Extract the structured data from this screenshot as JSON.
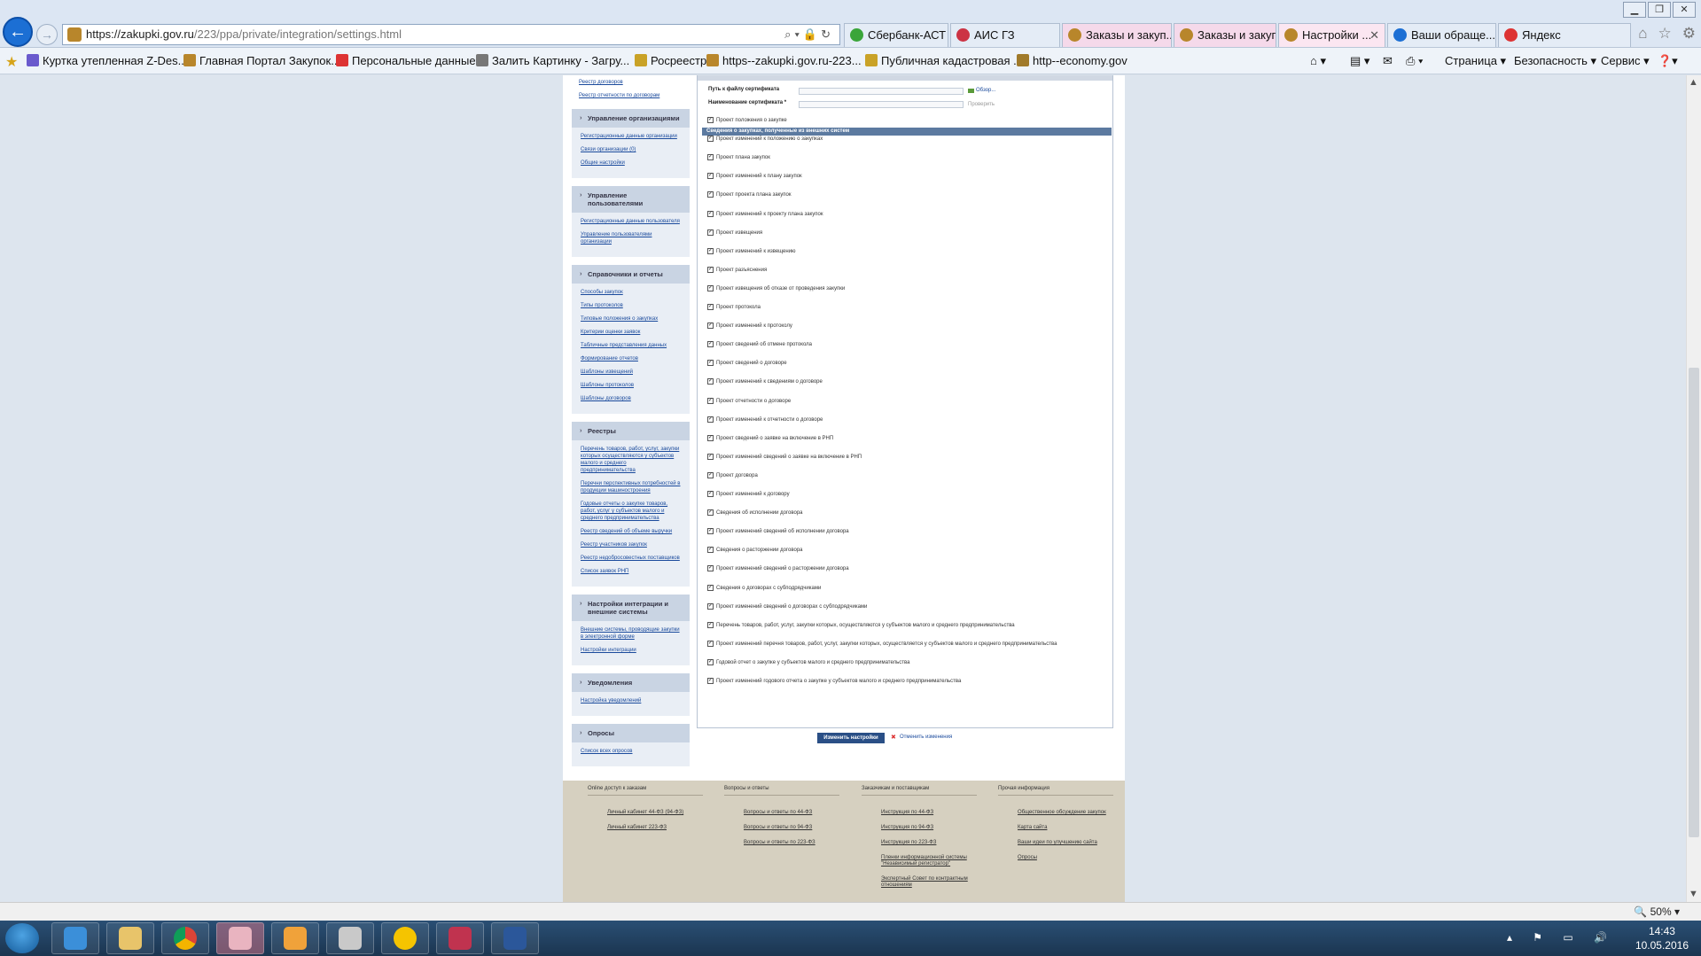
{
  "browser": {
    "url_host": "https://zakupki.gov.ru",
    "url_path": "/223/ppa/private/integration/settings.html",
    "tabs": [
      {
        "label": "Сбербанк-АСТ",
        "color": "#3aa53a"
      },
      {
        "label": "АИС ГЗ",
        "color": "#c34"
      },
      {
        "label": "Заказы и закуп...",
        "color": "#b8862b"
      },
      {
        "label": "Заказы и закуп...",
        "color": "#b8862b"
      },
      {
        "label": "Настройки ...",
        "color": "#b8862b"
      },
      {
        "label": "Ваши обраще...",
        "color": "#1c6fd4"
      },
      {
        "label": "Яндекс",
        "color": "#d33"
      }
    ],
    "favorites": [
      "Куртка утепленная Z-Des...",
      "Главная Портал Закупок...",
      "Персональные данные",
      "Залить Картинку - Загру...",
      "Росреестр",
      "https--zakupki.gov.ru-223...",
      "Публичная кадастровая ...",
      "http--economy.gov"
    ],
    "commands": {
      "page": "Страница",
      "security": "Безопасность",
      "service": "Сервис"
    },
    "zoom": "50%"
  },
  "sidebar": {
    "top_links": [
      "Реестр договоров",
      "Реестр отчетности по договорам"
    ],
    "groups": [
      {
        "title": "Управление организациями",
        "links": [
          "Регистрационные данные организации",
          "Связи организации (0)",
          "Общие настройки"
        ]
      },
      {
        "title": "Управление пользователями",
        "links": [
          "Регистрационные данные пользователя",
          "Управление пользователями организации"
        ]
      },
      {
        "title": "Справочники и отчеты",
        "links": [
          "Способы закупок",
          "Типы протоколов",
          "Типовые положения о закупках",
          "Критерии оценки заявок",
          "Табличные представления данных",
          "Формирование отчетов",
          "Шаблоны извещений",
          "Шаблоны протоколов",
          "Шаблоны договоров"
        ]
      },
      {
        "title": "Реестры",
        "links": [
          "Перечень товаров, работ, услуг, закупки которых осуществляются у субъектов малого и среднего предпринимательства",
          "Перечни перспективных потребностей в продукции машиностроения",
          "Годовые отчеты о закупке товаров, работ, услуг у субъектов малого и среднего предпринимательства",
          "Реестр сведений об объеме выручки",
          "Реестр участников закупок",
          "Реестр недобросовестных поставщиков",
          "Список заявок РНП"
        ]
      },
      {
        "title": "Настройки интеграции и внешние системы",
        "links": [
          "Внешние системы, проводящие закупки в электронной форме",
          "Настройки интеграции"
        ]
      },
      {
        "title": "Уведомления",
        "links": [
          "Настройка уведомлений"
        ]
      },
      {
        "title": "Опросы",
        "links": [
          "Список всех опросов"
        ]
      }
    ]
  },
  "main": {
    "cert_path_label": "Путь к файлу сертификата",
    "cert_name_label": "Наименование сертификата *",
    "browse_label": "Обзор...",
    "check_label": "Проверить",
    "section_title": "Сведения о закупках, полученные из внешних систем",
    "checkboxes": [
      "Проект положения о закупке",
      "Проект изменений к положению о закупках",
      "Проект плана закупок",
      "Проект изменений к плану закупок",
      "Проект проекта плана закупок",
      "Проект изменений к проекту плана закупок",
      "Проект извещения",
      "Проект изменений к извещению",
      "Проект разъяснения",
      "Проект извещения об отказе от проведения закупки",
      "Проект протокола",
      "Проект изменений к протоколу",
      "Проект сведений об отмене протокола",
      "Проект сведений о договоре",
      "Проект изменений к сведениям о договоре",
      "Проект отчетности о договоре",
      "Проект изменений к отчетности о договоре",
      "Проект сведений о заявке на включение в РНП",
      "Проект изменений сведений о заявке на включение в РНП",
      "Проект договора",
      "Проект изменений к договору",
      "Сведения об исполнении договора",
      "Проект изменений сведений об исполнении договора",
      "Сведения о расторжении договора",
      "Проект изменений сведений о расторжении договора",
      "Сведения о договорах с субподрядчиками",
      "Проект изменений сведений о договорах с субподрядчиками",
      "Перечень товаров, работ, услуг, закупки которых, осуществляются у субъектов малого и среднего предпринимательства",
      "Проект изменений перечня товаров, работ, услуг, закупки которых, осуществляется у субъектов малого и среднего предпринимательства",
      "Годовой отчет о закупке у субъектов малого и среднего предпринимательства",
      "Проект изменений годового отчета о закупке у субъектов малого и среднего предпринимательства"
    ],
    "save_label": "Изменить настройки",
    "cancel_label": "Отменить изменения"
  },
  "footer": {
    "columns": [
      {
        "title": "Online доступ к заказам",
        "links": [
          "Личный кабинет 44-ФЗ (94-ФЗ)",
          "Личный кабинет 223-ФЗ"
        ]
      },
      {
        "title": "Вопросы и ответы",
        "links": [
          "Вопросы и ответы по 44-ФЗ",
          "Вопросы и ответы по 94-ФЗ",
          "Вопросы и ответы по 223-ФЗ"
        ]
      },
      {
        "title": "Заказчикам и поставщикам",
        "links": [
          "Инструкция по 44-ФЗ",
          "Инструкция по 94-ФЗ",
          "Инструкция по 223-ФЗ",
          "Пленки информационной системы \"Независимый регистратор\"",
          "Экспертный Совет по контрактным отношениям"
        ]
      },
      {
        "title": "Прочая информация",
        "links": [
          "Общественное обсуждение закупок",
          "Карта сайта",
          "Ваши идеи по улучшению сайта",
          "Опросы"
        ]
      }
    ]
  },
  "taskbar": {
    "time": "14:43",
    "date": "10.05.2016"
  }
}
